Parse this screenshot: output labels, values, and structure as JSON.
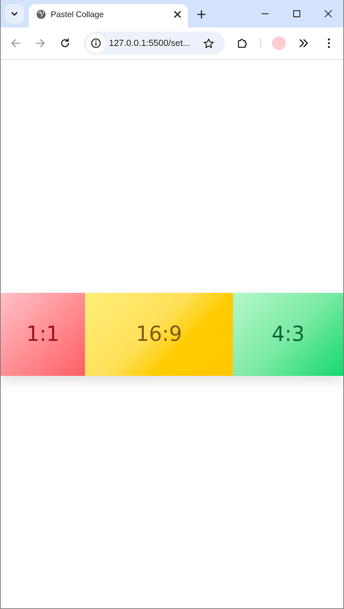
{
  "browser": {
    "tab": {
      "title": "Pastel Collage",
      "favicon": "globe-icon"
    },
    "address_bar": {
      "url": "127.0.0.1:5500/set..."
    },
    "profile_color": "#ffcdd2",
    "tabstrip_color": "#d3e3fd"
  },
  "page": {
    "tiles": [
      {
        "label": "1:1",
        "color_from": "#ffc1c7",
        "color_to": "#ff5f63",
        "text_color": "#9b1420"
      },
      {
        "label": "16:9",
        "color_from": "#ffee7a",
        "color_to": "#ffc700",
        "text_color": "#855a07"
      },
      {
        "label": "4:3",
        "color_from": "#b4f8c8",
        "color_to": "#15d86e",
        "text_color": "#0e6a36"
      }
    ]
  }
}
